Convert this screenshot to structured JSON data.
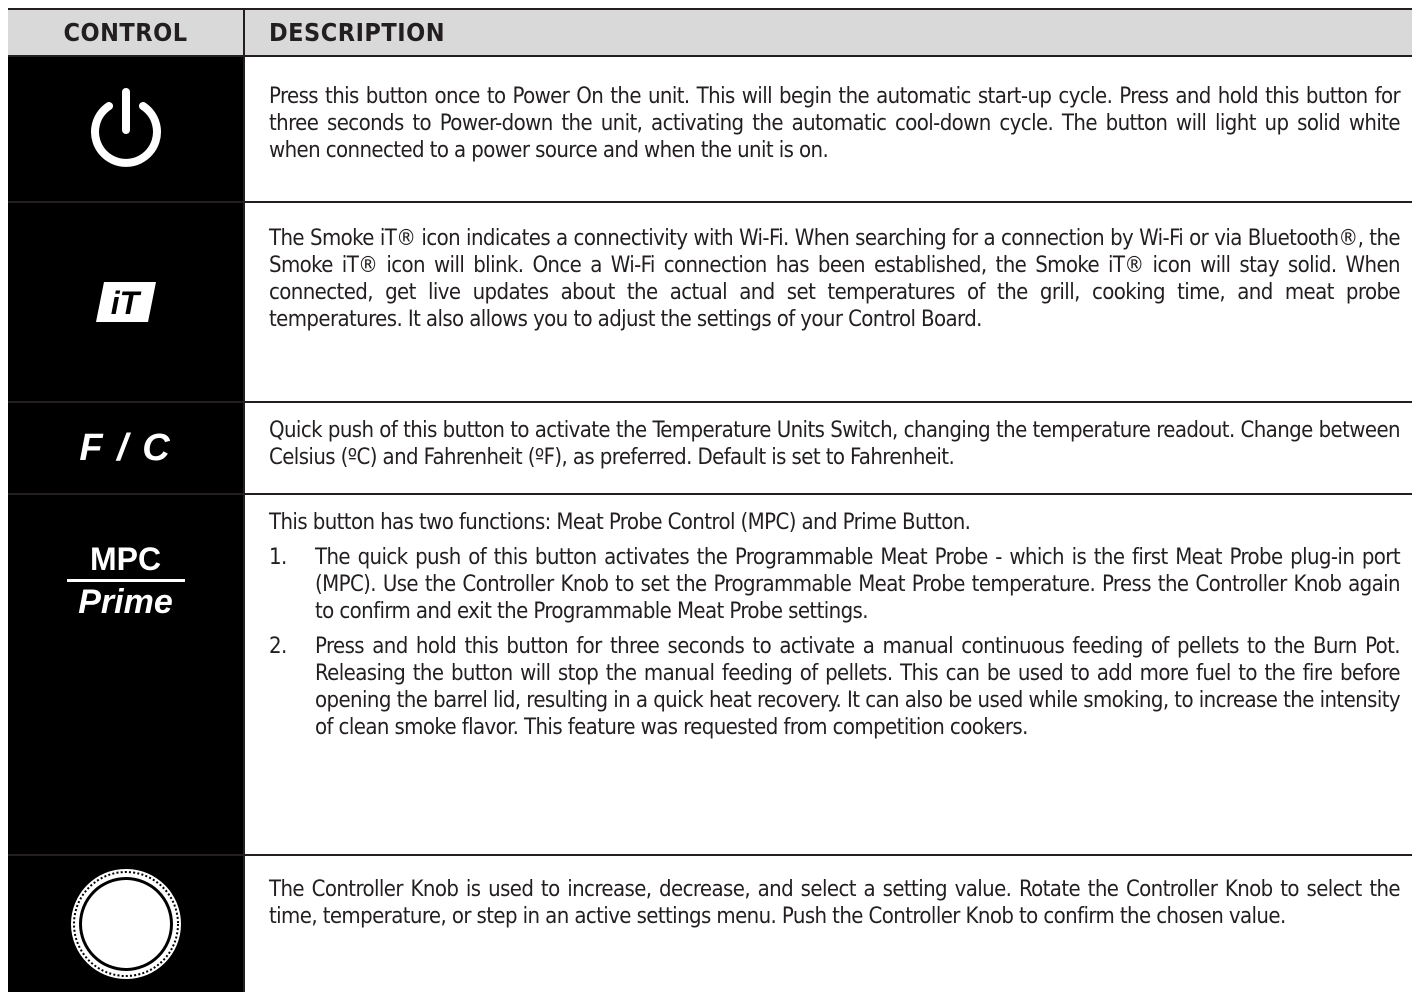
{
  "header": {
    "control": "CONTROL",
    "description": "DESCRIPTION"
  },
  "rows": [
    {
      "icon": "power-icon",
      "description": "Press this button once to Power On the unit. This will begin the automatic start-up cycle. Press and hold this button for three seconds to Power-down the unit, activating the automatic cool-down cycle. The button will light up solid white when connected to a power source and when the unit is on."
    },
    {
      "icon": "smoke-it-icon",
      "icon_text": "iT",
      "description": "The Smoke iT® icon indicates a connectivity with Wi-Fi. When searching for a connection by Wi-Fi or via Bluetooth®, the Smoke iT® icon will blink. Once a Wi-Fi connection has been established, the Smoke iT® icon will stay solid. When connected, get live updates about the actual and set temperatures of the grill, cooking time, and meat probe temperatures. It also allows you to adjust the settings of your Control Board."
    },
    {
      "icon": "fc-toggle-icon",
      "icon_text": "F / C",
      "description": "Quick push of this button to activate the Temperature Units Switch, changing the temperature readout. Change between Celsius (ºC) and Fahrenheit (ºF), as preferred. Default is set to Fahrenheit."
    },
    {
      "icon": "mpc-prime-icon",
      "icon_top": "MPC",
      "icon_bottom": "Prime",
      "description": "This button has two functions: Meat Probe Control (MPC) and Prime Button.",
      "steps": [
        {
          "number": "1.",
          "text": "The quick push of this button activates the Programmable Meat Probe - which is the first Meat Probe plug-in port (MPC). Use the Controller Knob to set the Programmable Meat Probe temperature. Press the Controller Knob again to confirm and exit the Programmable Meat Probe settings."
        },
        {
          "number": "2.",
          "text": "Press and hold this button for three seconds to activate a manual continuous feeding of pellets to the Burn Pot. Releasing the button will stop the manual feeding of pellets. This can be used to add more fuel to the fire before opening the barrel lid, resulting in a quick heat recovery. It can also be used while smoking, to increase the intensity of clean smoke flavor. This feature was requested from competition cookers."
        }
      ]
    },
    {
      "icon": "controller-knob-icon",
      "description": "The Controller Knob is used to increase, decrease, and select a setting value. Rotate the Controller Knob to select the time, temperature, or step in an active settings menu. Push the Controller Knob to confirm the chosen value."
    }
  ]
}
